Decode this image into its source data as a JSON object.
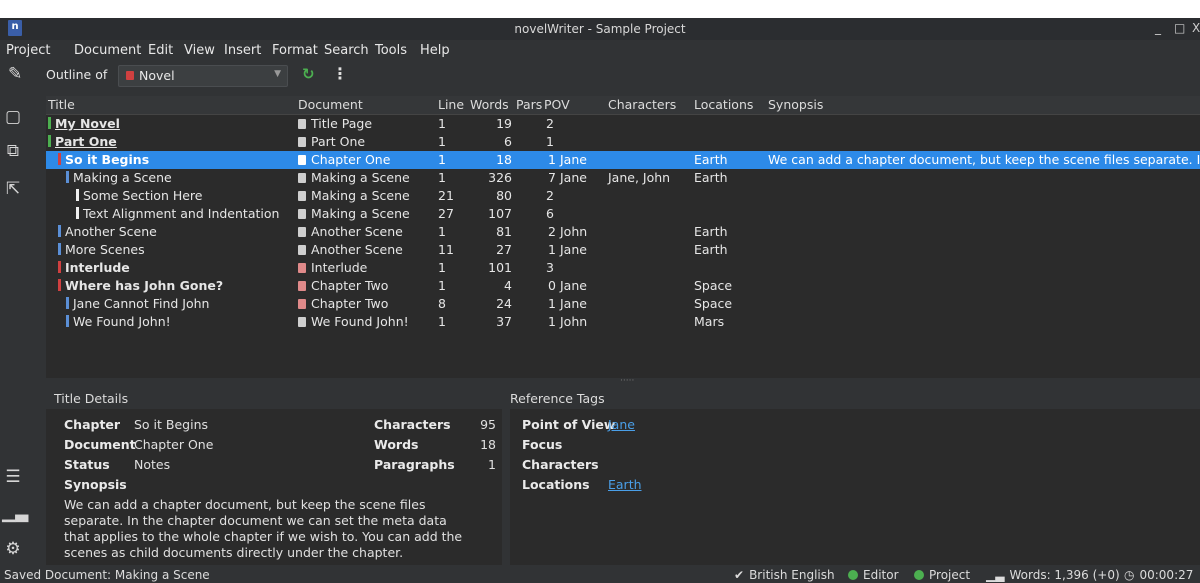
{
  "window": {
    "title": "novelWriter - Sample Project",
    "logo": "n",
    "minimize": "_",
    "maximize": "□",
    "close": "X"
  },
  "menu": [
    "Project",
    "Document",
    "Edit",
    "View",
    "Insert",
    "Format",
    "Search",
    "Tools",
    "Help"
  ],
  "toolbar": {
    "outline_label": "Outline of",
    "root_value": "Novel"
  },
  "table": {
    "headers": [
      "Title",
      "Document",
      "Line",
      "Words",
      "Pars",
      "POV",
      "Characters",
      "Locations",
      "Synopsis"
    ],
    "rows": [
      {
        "title": "My Novel",
        "doc": "Title Page",
        "line": "1",
        "words": "19",
        "pars": "2",
        "pov": "",
        "chars": "",
        "locs": "",
        "syn": ""
      },
      {
        "title": "Part One",
        "doc": "Part One",
        "line": "1",
        "words": "6",
        "pars": "1",
        "pov": "",
        "chars": "",
        "locs": "",
        "syn": ""
      },
      {
        "title": "So it Begins",
        "doc": "Chapter One",
        "line": "1",
        "words": "18",
        "pars": "1",
        "pov": "Jane",
        "chars": "",
        "locs": "Earth",
        "syn": "We can add a chapter document, but keep the scene files separate. In the c…"
      },
      {
        "title": "Making a Scene",
        "doc": "Making a Scene",
        "line": "1",
        "words": "326",
        "pars": "7",
        "pov": "Jane",
        "chars": "Jane, John",
        "locs": "Earth",
        "syn": ""
      },
      {
        "title": "Some Section Here",
        "doc": "Making a Scene",
        "line": "21",
        "words": "80",
        "pars": "2",
        "pov": "",
        "chars": "",
        "locs": "",
        "syn": ""
      },
      {
        "title": "Text Alignment and Indentation",
        "doc": "Making a Scene",
        "line": "27",
        "words": "107",
        "pars": "6",
        "pov": "",
        "chars": "",
        "locs": "",
        "syn": ""
      },
      {
        "title": "Another Scene",
        "doc": "Another Scene",
        "line": "1",
        "words": "81",
        "pars": "2",
        "pov": "John",
        "chars": "",
        "locs": "Earth",
        "syn": ""
      },
      {
        "title": "More Scenes",
        "doc": "Another Scene",
        "line": "11",
        "words": "27",
        "pars": "1",
        "pov": "Jane",
        "chars": "",
        "locs": "Earth",
        "syn": ""
      },
      {
        "title": "Interlude",
        "doc": "Interlude",
        "line": "1",
        "words": "101",
        "pars": "3",
        "pov": "",
        "chars": "",
        "locs": "",
        "syn": ""
      },
      {
        "title": "Where has John Gone?",
        "doc": "Chapter Two",
        "line": "1",
        "words": "4",
        "pars": "0",
        "pov": "Jane",
        "chars": "",
        "locs": "Space",
        "syn": ""
      },
      {
        "title": "Jane Cannot Find John",
        "doc": "Chapter Two",
        "line": "8",
        "words": "24",
        "pars": "1",
        "pov": "Jane",
        "chars": "",
        "locs": "Space",
        "syn": ""
      },
      {
        "title": "We Found John!",
        "doc": "We Found John!",
        "line": "1",
        "words": "37",
        "pars": "1",
        "pov": "John",
        "chars": "",
        "locs": "Mars",
        "syn": ""
      }
    ]
  },
  "details": {
    "title_header": "Title Details",
    "ref_header": "Reference Tags",
    "chapter_label": "Chapter",
    "chapter_value": "So it Begins",
    "document_label": "Document",
    "document_value": "Chapter One",
    "status_label": "Status",
    "status_value": "Notes",
    "synopsis_label": "Synopsis",
    "synopsis_text": "We can add a chapter document, but keep the scene files separate. In the chapter document we can set the meta data that applies to the whole chapter if we wish to. You can add the scenes as child documents directly under the chapter.",
    "characters_label": "Characters",
    "characters_value": "95",
    "words_label": "Words",
    "words_value": "18",
    "paragraphs_label": "Paragraphs",
    "paragraphs_value": "1",
    "pov_label": "Point of View",
    "pov_value": "Jane",
    "focus_label": "Focus",
    "chars_label": "Characters",
    "locations_label": "Locations",
    "locations_value": "Earth"
  },
  "status": {
    "message": "Saved Document: Making a Scene",
    "language": "British English",
    "editor": "Editor",
    "project": "Project",
    "words": "Words: 1,396 (+0)",
    "time": "00:00:27"
  },
  "colors": {
    "selection": "#2d8ae8",
    "title_bar": "#4caf50",
    "chapter_bar": "#d04040",
    "scene_bar": "#5b8fd6",
    "link": "#4a9fe8"
  },
  "icons": [
    "edit-outline-icon",
    "project-tree-icon",
    "novel-tree-icon",
    "export-icon",
    "outline-icon",
    "statistics-icon",
    "settings-icon",
    "refresh-icon",
    "more-icon"
  ]
}
